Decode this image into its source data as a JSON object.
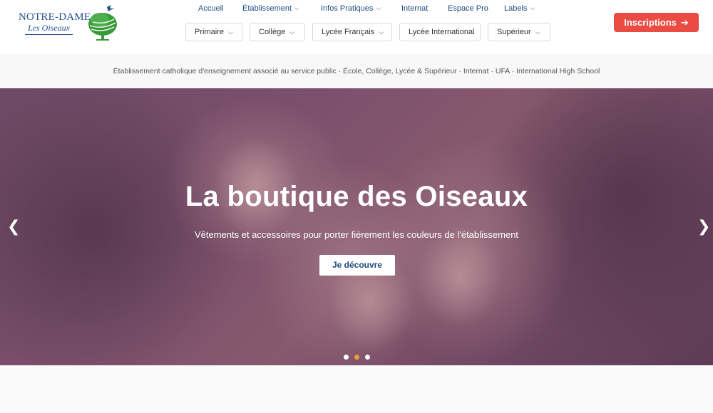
{
  "logo": {
    "name": "NOTRE-DAME",
    "subtitle": "Les Oiseaux",
    "icon": "tree-and-bird-logo"
  },
  "topnav": [
    {
      "label": "Accueil",
      "has_dropdown": false
    },
    {
      "label": "Établissement",
      "has_dropdown": true
    },
    {
      "label": "Infos Pratiques",
      "has_dropdown": true
    },
    {
      "label": "Internat",
      "has_dropdown": false
    },
    {
      "label": "Espace Pro",
      "has_dropdown": false
    },
    {
      "label": "Labels",
      "has_dropdown": true
    }
  ],
  "subnav": [
    {
      "label": "Primaire",
      "has_dropdown": true
    },
    {
      "label": "Collège",
      "has_dropdown": true
    },
    {
      "label": "Lycée Français",
      "has_dropdown": true
    },
    {
      "label": "Lycée International",
      "has_dropdown": false
    },
    {
      "label": "Supérieur",
      "has_dropdown": true
    }
  ],
  "cta": {
    "label": "Inscriptions",
    "icon": "arrow-right-icon",
    "color": "#ea4b43"
  },
  "tagline": "Établissement catholique d'enseignement associé au service public · École, Collège, Lycée & Supérieur · Internat · UFA · International High School",
  "hero": {
    "title": "La boutique des Oiseaux",
    "subtitle": "Vêtements et accessoires pour porter fièrement les couleurs de l'établissement",
    "button": "Je découvre",
    "prev_icon": "chevron-left-icon",
    "next_icon": "chevron-right-icon",
    "slides": 3,
    "active_slide": 2
  },
  "colors": {
    "primary": "#1d4a80",
    "accent": "#ea4b43",
    "dot_active": "#f0a030"
  }
}
